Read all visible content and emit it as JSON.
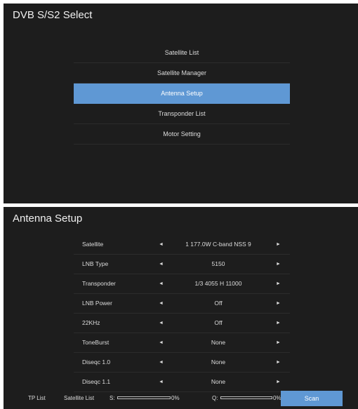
{
  "screen1": {
    "title": "DVB S/S2 Select",
    "menu": [
      {
        "label": "Satellite List"
      },
      {
        "label": "Satellite Manager"
      },
      {
        "label": "Antenna Setup"
      },
      {
        "label": "Transponder List"
      },
      {
        "label": "Motor Setting"
      }
    ],
    "selected_index": 2,
    "colors": {
      "background": "#1d1d1d",
      "highlight": "#5f98d4"
    }
  },
  "screen2": {
    "title": "Antenna Setup",
    "arrow_left": "◄",
    "arrow_right": "►",
    "settings": [
      {
        "label": "Satellite",
        "value": "1 177.0W C-band NSS 9"
      },
      {
        "label": "LNB Type",
        "value": "5150"
      },
      {
        "label": "Transponder",
        "value": "1/3 4055 H 11000"
      },
      {
        "label": "LNB Power",
        "value": "Off"
      },
      {
        "label": "22KHz",
        "value": "Off"
      },
      {
        "label": "ToneBurst",
        "value": "None"
      },
      {
        "label": "Diseqc 1.0",
        "value": "None"
      },
      {
        "label": "Diseqc 1.1",
        "value": "None"
      }
    ],
    "footer": {
      "tp_list": "TP List",
      "satellite_list": "Satellite List",
      "s_label": "S:",
      "s_value": "0%",
      "s_level": 0,
      "q_label": "Q:",
      "q_value": "0%",
      "q_level": 0,
      "scan": "Scan"
    }
  }
}
